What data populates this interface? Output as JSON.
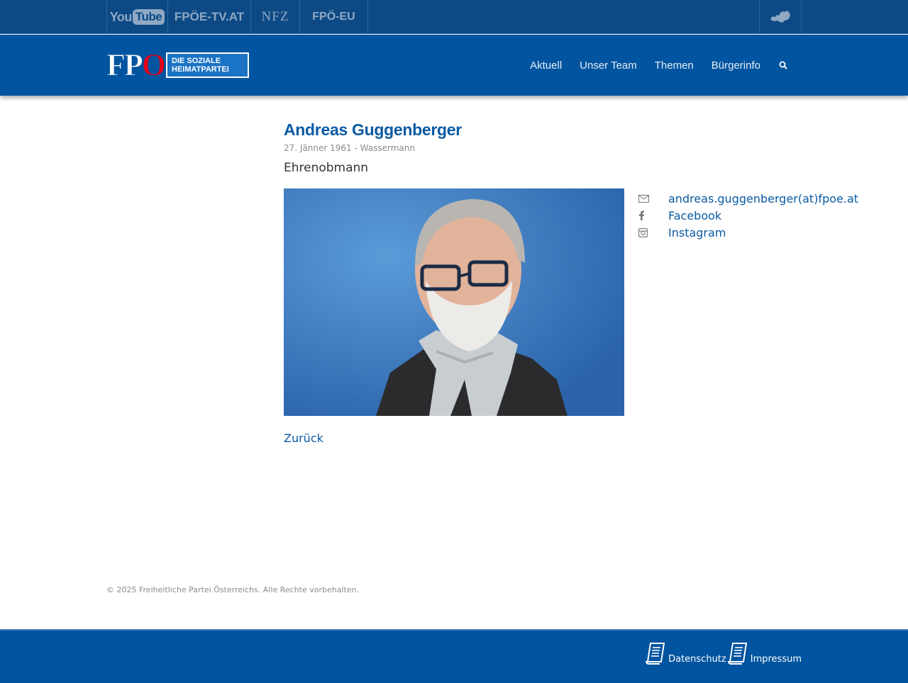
{
  "topbar": {
    "youtube": {
      "you": "You",
      "tube": "Tube"
    },
    "fpoetv": "FPÖE-TV.AT",
    "nfz": "NFZ",
    "fpoeu": "FPÖ-EU"
  },
  "header": {
    "logo_letters": "FPÖ",
    "logo_tagline": "DIE SOZIALE HEIMATPARTEI",
    "nav": [
      "Aktuell",
      "Unser Team",
      "Themen",
      "Bürgerinfo"
    ]
  },
  "person": {
    "name": "Andreas Guggenberger",
    "birth": "27. Jänner 1961 - Wassermann",
    "role": "Ehrenobmann",
    "contacts": {
      "email": "andreas.guggenberger(at)fpoe.at",
      "facebook": "Facebook",
      "instagram": "Instagram"
    }
  },
  "back_label": "Zurück",
  "copyright": "© 2025 Freiheitliche Partei Österreichs. Alle Rechte vorbehalten.",
  "footer": {
    "datenschutz": "Datenschutz",
    "impressum": "Impressum"
  },
  "colors": {
    "topbar": "#0d4a85",
    "header": "#0054a0",
    "link": "#0a5aa3",
    "logo_red": "#e2001a"
  },
  "icons": [
    "youtube-logo",
    "austria-map-icon",
    "search-icon",
    "envelope-icon",
    "facebook-icon",
    "instagram-icon",
    "document-icon"
  ]
}
